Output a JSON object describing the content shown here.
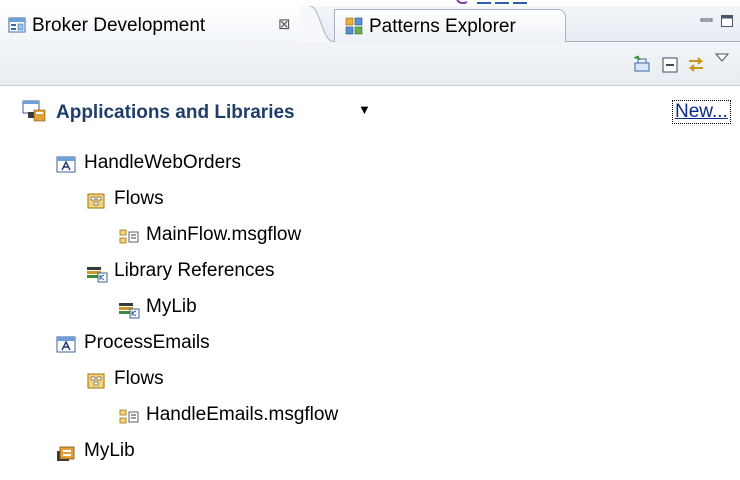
{
  "tabs": [
    {
      "label": "Broker Development",
      "close": "⊠",
      "active": true
    },
    {
      "label": "Patterns Explorer",
      "active": false
    }
  ],
  "view_controls": {
    "minimize": "minimize-icon",
    "maximize": "maximize-icon"
  },
  "toolbar": {
    "icons": [
      "new-wizard-icon",
      "collapse-all-icon",
      "link-with-editor-icon",
      "view-menu-icon"
    ]
  },
  "section": {
    "title": "Applications and Libraries",
    "caret": "▼",
    "new_link": "New..."
  },
  "tree": [
    {
      "label": "HandleWebOrders",
      "icon": "application-icon",
      "level": 0
    },
    {
      "label": "Flows",
      "icon": "flows-folder-icon",
      "level": 1
    },
    {
      "label": "MainFlow.msgflow",
      "icon": "msgflow-file-icon",
      "level": 2
    },
    {
      "label": "Library References",
      "icon": "library-references-icon",
      "level": 1
    },
    {
      "label": "MyLib",
      "icon": "library-reference-icon",
      "level": 2
    },
    {
      "label": "ProcessEmails",
      "icon": "application-icon",
      "level": 0
    },
    {
      "label": "Flows",
      "icon": "flows-folder-icon",
      "level": 1
    },
    {
      "label": "HandleEmails.msgflow",
      "icon": "msgflow-file-icon",
      "level": 2
    },
    {
      "label": "MyLib",
      "icon": "library-icon",
      "level": 0
    }
  ],
  "colors": {
    "section_title": "#1f3d6b",
    "link": "#0a2a8a",
    "tab_border": "#a9b4c2"
  }
}
